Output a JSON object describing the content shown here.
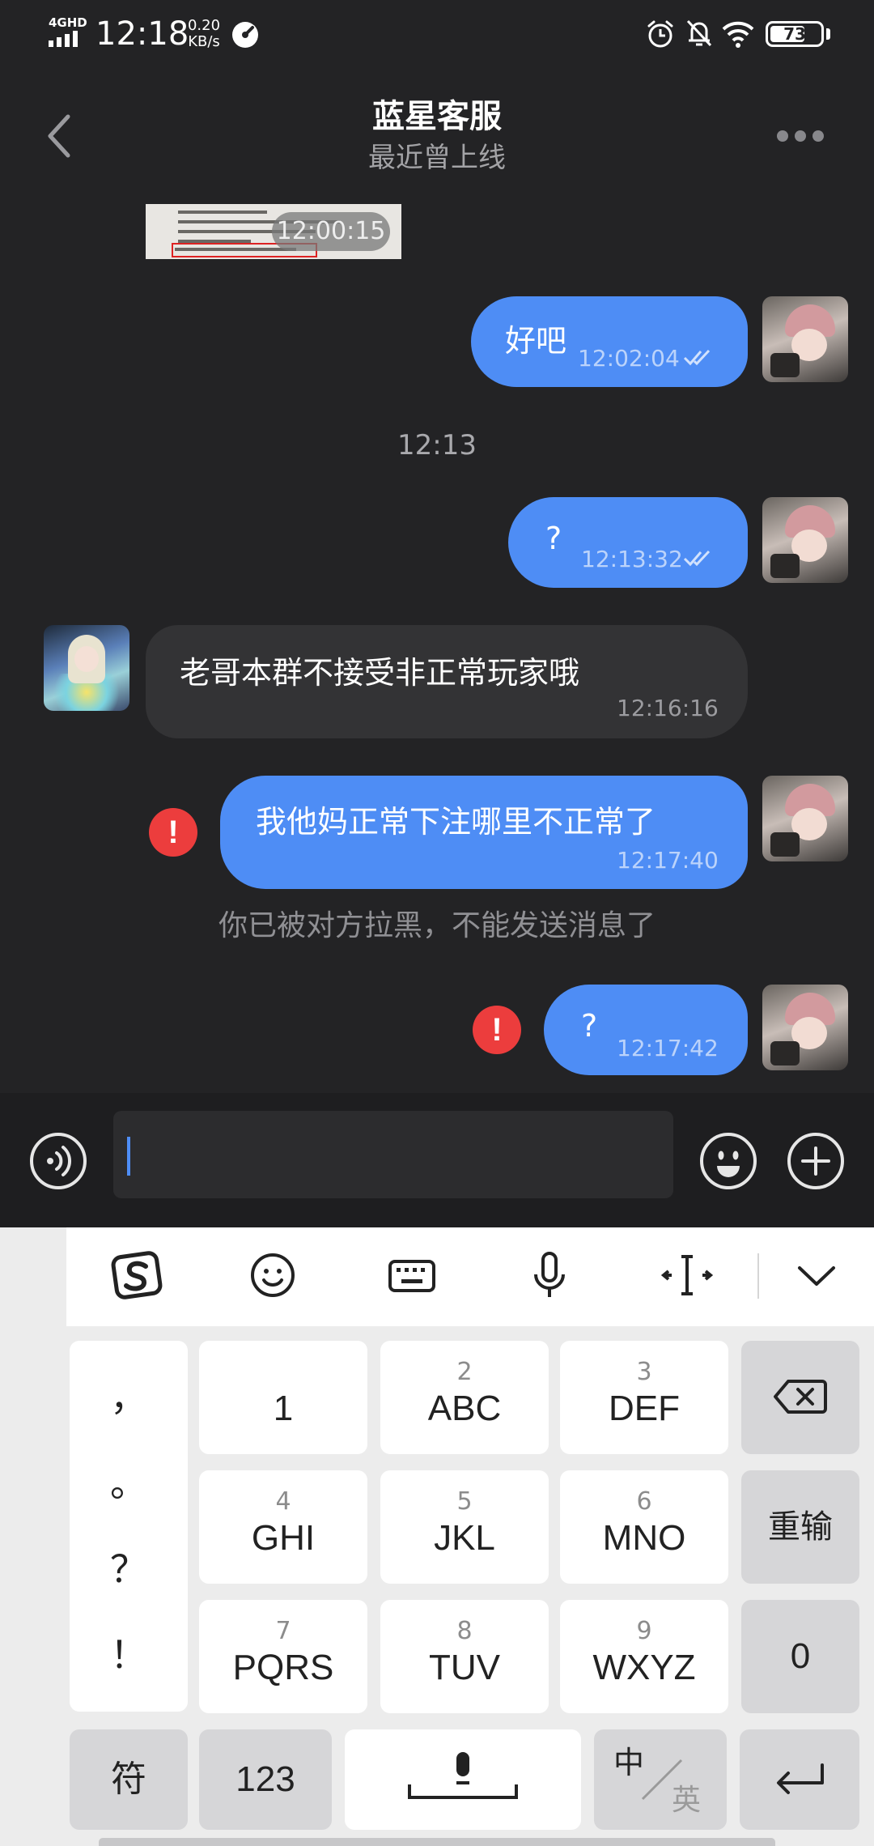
{
  "status_bar": {
    "network": "4GHD",
    "time": "12:18",
    "speed_value": "0.20",
    "speed_unit": "KB/s",
    "battery": "73",
    "battery_level_percent": 73,
    "icons": [
      "signal-icon",
      "disc-icon",
      "alarm-icon",
      "mute-icon",
      "wifi-icon",
      "battery-icon"
    ]
  },
  "header": {
    "title": "蓝星客服",
    "subtitle": "最近曾上线"
  },
  "messages": [
    {
      "type": "image",
      "time": "12:00:15"
    },
    {
      "type": "outgoing",
      "text": "好吧",
      "time": "12:02:04",
      "read": true
    },
    {
      "type": "divider",
      "text": "12:13"
    },
    {
      "type": "outgoing",
      "text": "?",
      "time": "12:13:32",
      "read": true
    },
    {
      "type": "incoming",
      "text": "老哥本群不接受非正常玩家哦",
      "time": "12:16:16"
    },
    {
      "type": "outgoing",
      "text": "我他妈正常下注哪里不正常了",
      "time": "12:17:40",
      "failed": true
    },
    {
      "type": "system",
      "text": "你已被对方拉黑，不能发送消息了"
    },
    {
      "type": "outgoing",
      "text": "?",
      "time": "12:17:42",
      "failed": true
    }
  ],
  "input": {
    "value": ""
  },
  "keyboard": {
    "toolbar": [
      "sogou-logo-icon",
      "emoji-icon",
      "keyboard-icon",
      "microphone-icon",
      "cursor-move-icon",
      "collapse-icon"
    ],
    "punctuation": [
      "，",
      "。",
      "？",
      "！"
    ],
    "keys": [
      {
        "num": "",
        "label": "1"
      },
      {
        "num": "2",
        "label": "ABC"
      },
      {
        "num": "3",
        "label": "DEF"
      },
      {
        "num": "4",
        "label": "GHI"
      },
      {
        "num": "5",
        "label": "JKL"
      },
      {
        "num": "6",
        "label": "MNO"
      },
      {
        "num": "7",
        "label": "PQRS"
      },
      {
        "num": "8",
        "label": "TUV"
      },
      {
        "num": "9",
        "label": "WXYZ"
      }
    ],
    "retype": "重输",
    "zero": "0",
    "symbols": "符",
    "numbers": "123",
    "lang_cn": "中",
    "lang_en": "英"
  },
  "colors": {
    "background": "#232325",
    "outgoing_bubble": "#4e8df5",
    "incoming_bubble": "#333335",
    "error": "#ec3d3d"
  }
}
